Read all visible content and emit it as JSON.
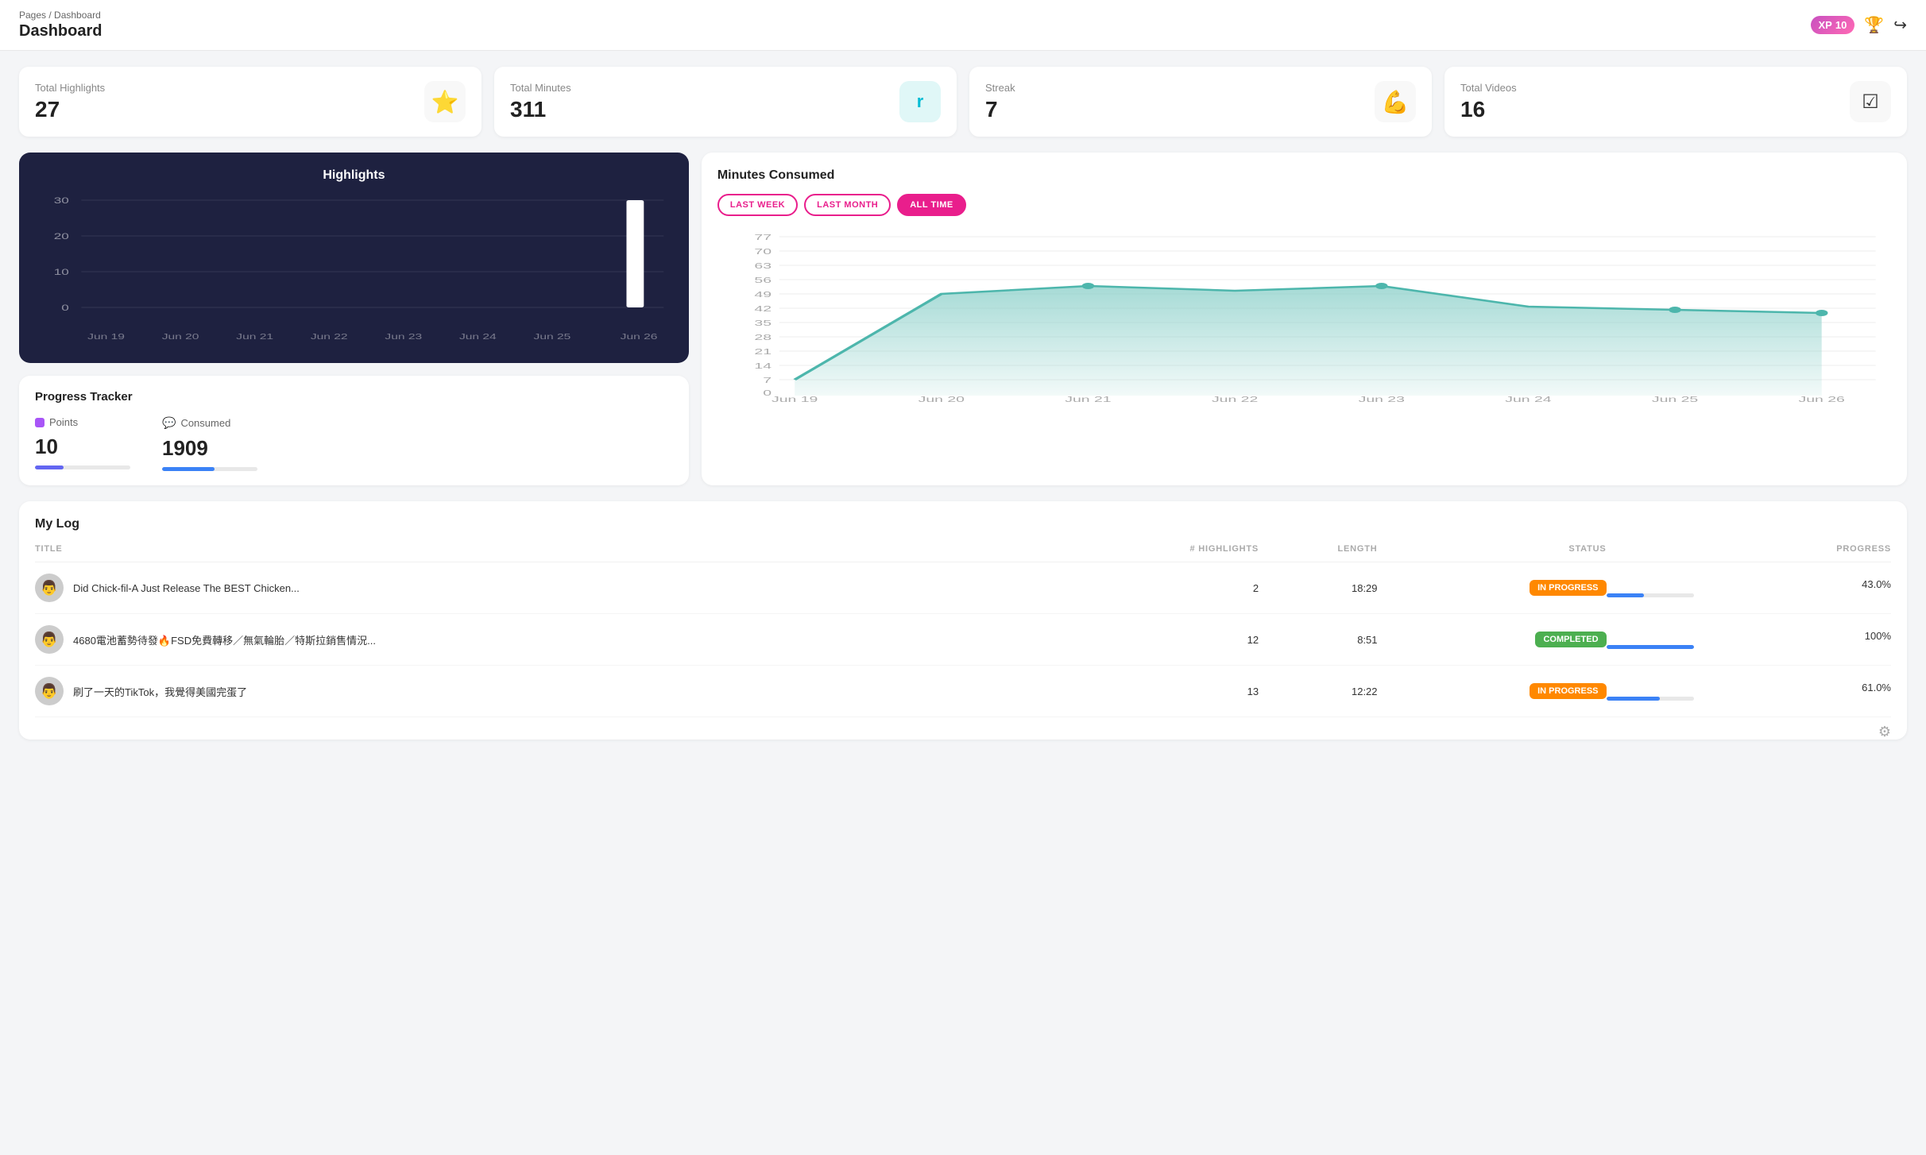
{
  "header": {
    "breadcrumb_pages": "Pages",
    "breadcrumb_sep": "/",
    "breadcrumb_current": "Dashboard",
    "title": "Dashboard",
    "xp_label": "XP",
    "xp_value": "10"
  },
  "stat_cards": [
    {
      "label": "Total Highlights",
      "value": "27",
      "icon": "⭐"
    },
    {
      "label": "Total Minutes",
      "value": "311",
      "icon": "🟢"
    },
    {
      "label": "Streak",
      "value": "7",
      "icon": "💪"
    },
    {
      "label": "Total Videos",
      "value": "16",
      "icon": "✅"
    }
  ],
  "highlights_chart": {
    "title": "Highlights",
    "y_labels": [
      "30",
      "20",
      "10",
      "0"
    ],
    "x_labels": [
      "Jun 19",
      "Jun 20",
      "Jun 21",
      "Jun 22",
      "Jun 23",
      "Jun 24",
      "Jun 25",
      "Jun 26"
    ]
  },
  "progress_tracker": {
    "title": "Progress Tracker",
    "metrics": [
      {
        "label": "Points",
        "icon": "🟣",
        "value": "10",
        "fill_pct": 30,
        "color": "#6366f1"
      },
      {
        "label": "Consumed",
        "icon": "💬",
        "value": "1909",
        "fill_pct": 55,
        "color": "#3b82f6"
      }
    ]
  },
  "minutes_consumed": {
    "title": "Minutes Consumed",
    "filters": [
      "LAST WEEK",
      "LAST MONTH",
      "ALL TIME"
    ],
    "active_filter": "ALL TIME",
    "y_labels": [
      "77",
      "70",
      "63",
      "56",
      "49",
      "42",
      "35",
      "28",
      "21",
      "14",
      "7",
      "0"
    ],
    "x_labels": [
      "Jun 19",
      "Jun 20",
      "Jun 21",
      "Jun 22",
      "Jun 23",
      "Jun 24",
      "Jun 25",
      "Jun 26"
    ]
  },
  "my_log": {
    "title": "My Log",
    "columns": {
      "title": "TITLE",
      "highlights": "# HIGHLIGHTS",
      "length": "LENGTH",
      "status": "STATUS",
      "progress": "PROGRESS"
    },
    "rows": [
      {
        "title": "Did Chick-fil-A Just Release The BEST Chicken...",
        "thumb": "👨",
        "highlights": "2",
        "length": "18:29",
        "status": "IN PROGRESS",
        "status_type": "in-progress",
        "progress_pct": "43.0%",
        "progress_val": 43
      },
      {
        "title": "4680電池蓄勢待發🔥FSD免費轉移／無氣輪胎／特斯拉銷售情況...",
        "thumb": "👨",
        "highlights": "12",
        "length": "8:51",
        "status": "COMPLETED",
        "status_type": "completed",
        "progress_pct": "100%",
        "progress_val": 100
      },
      {
        "title": "刷了一天的TikTok，我覺得美國完蛋了",
        "thumb": "👨",
        "highlights": "13",
        "length": "12:22",
        "status": "IN PROGRESS",
        "status_type": "in-progress",
        "progress_pct": "61.0%",
        "progress_val": 61
      }
    ]
  }
}
